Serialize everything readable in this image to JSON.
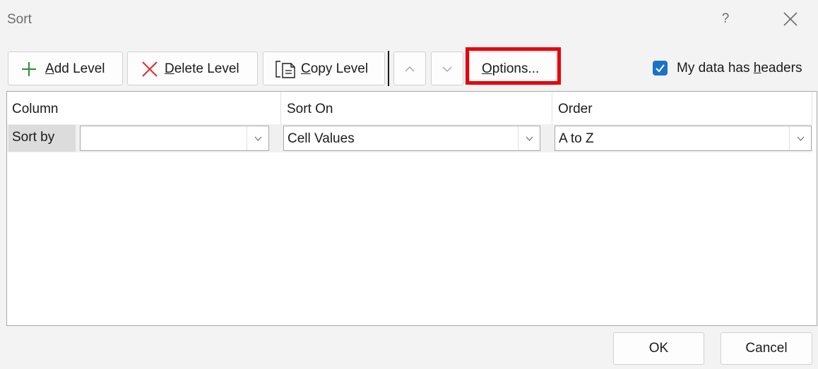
{
  "dialog": {
    "title": "Sort",
    "help_label": "?"
  },
  "toolbar": {
    "add_level": {
      "mnemonic": "A",
      "rest": "dd Level",
      "icon": "plus-icon",
      "icon_color": "#2e8b3d"
    },
    "delete_level": {
      "mnemonic": "D",
      "rest": "elete Level",
      "icon": "x-icon",
      "icon_color": "#e02d2d"
    },
    "copy_level": {
      "mnemonic": "C",
      "rest": "opy Level",
      "icon": "copy-icon"
    },
    "move_up": {
      "icon": "chevron-up-icon"
    },
    "move_down": {
      "icon": "chevron-down-icon"
    },
    "options": {
      "mnemonic": "O",
      "rest": "ptions...",
      "highlight_color": "#e8000b"
    },
    "headers_checkbox": {
      "checked": true,
      "label_before": "My data has ",
      "mnemonic": "h",
      "label_after": "eaders",
      "color": "#1a73c7"
    }
  },
  "grid": {
    "columns": [
      "Column",
      "Sort On",
      "Order"
    ],
    "rows": [
      {
        "label": "Sort by",
        "column_value": "",
        "sort_on": "Cell Values",
        "order": "A to Z"
      }
    ]
  },
  "footer": {
    "ok_label": "OK",
    "cancel_label": "Cancel"
  }
}
